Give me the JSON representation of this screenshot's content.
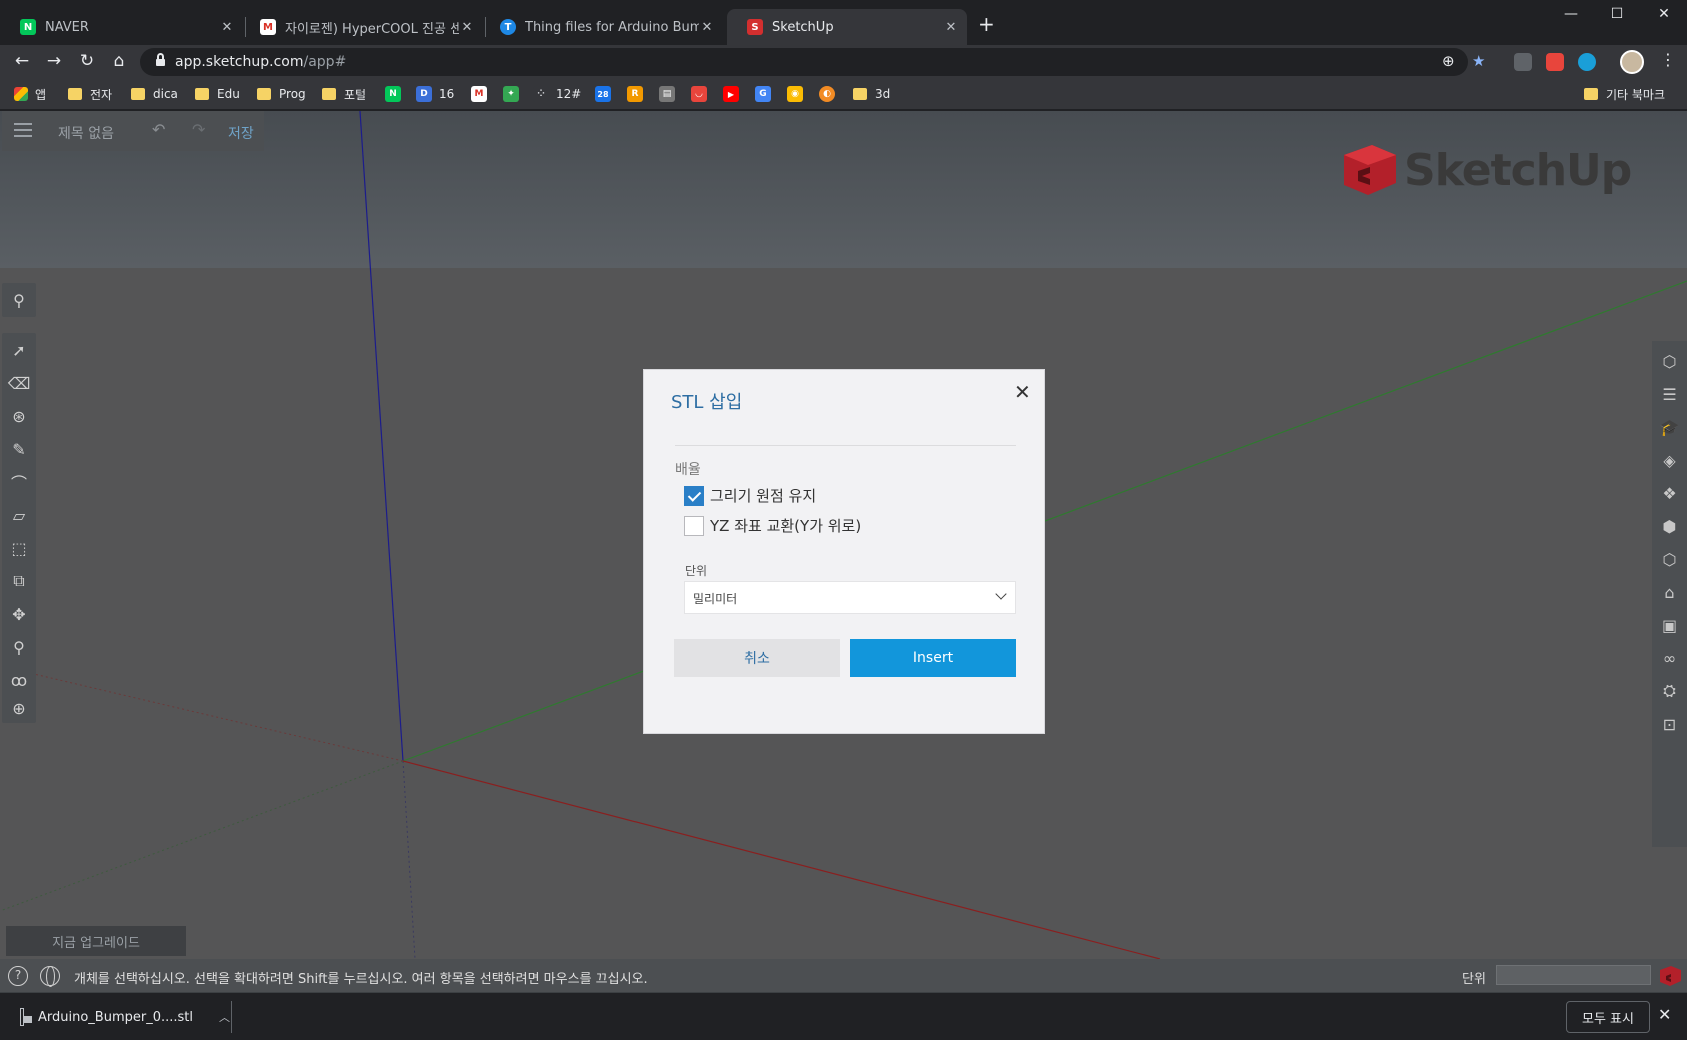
{
  "browser": {
    "tabs": [
      {
        "title": "NAVER",
        "icon": "naver-icon",
        "color": "#03c75a",
        "glyph": "N"
      },
      {
        "title": "자이로젠) HyperCOOL 진공 센서",
        "icon": "gmail-icon",
        "color": "#ffffff",
        "glyph": "M"
      },
      {
        "title": "Thing files for Arduino Bumper",
        "icon": "thingiverse-icon",
        "color": "#1e88e5",
        "glyph": "T"
      },
      {
        "title": "SketchUp",
        "icon": "sketchup-icon",
        "color": "#d32f2f",
        "glyph": "S"
      }
    ],
    "active_tab": 3,
    "new_tab": "+",
    "url_domain": "app.sketchup.com",
    "url_path": "/app#",
    "bookmarks": {
      "apps": "앱",
      "items": [
        {
          "label": "전자",
          "type": "folder"
        },
        {
          "label": "dica",
          "type": "folder"
        },
        {
          "label": "Edu",
          "type": "folder"
        },
        {
          "label": "Prog",
          "type": "folder"
        },
        {
          "label": "포털",
          "type": "folder"
        },
        {
          "label": "",
          "type": "icon",
          "color": "#03c75a",
          "glyph": "N"
        },
        {
          "label": "16",
          "type": "icon",
          "color": "#3b6fd8",
          "glyph": "D"
        },
        {
          "label": "",
          "type": "icon",
          "color": "#d93025",
          "glyph": "M"
        },
        {
          "label": "",
          "type": "icon",
          "color": "#34a853",
          "glyph": "✦"
        },
        {
          "label": "12#",
          "type": "icon",
          "color": "#35363a",
          "glyph": "⁘"
        },
        {
          "label": "",
          "type": "icon",
          "color": "#1a73e8",
          "glyph": "28"
        },
        {
          "label": "",
          "type": "icon",
          "color": "#f29900",
          "glyph": "R"
        },
        {
          "label": "",
          "type": "icon",
          "color": "#777777",
          "glyph": "▤"
        },
        {
          "label": "",
          "type": "icon",
          "color": "#e8453c",
          "glyph": "◡"
        },
        {
          "label": "",
          "type": "icon",
          "color": "#ff0000",
          "glyph": "▶"
        },
        {
          "label": "",
          "type": "icon",
          "color": "#4285f4",
          "glyph": "G"
        },
        {
          "label": "",
          "type": "icon",
          "color": "#fbbc04",
          "glyph": "◉"
        },
        {
          "label": "",
          "type": "icon",
          "color": "#f28b24",
          "glyph": "◐"
        },
        {
          "label": "3d",
          "type": "folder"
        }
      ],
      "other": "기타 북마크"
    }
  },
  "sketchup": {
    "doc_title": "제목 없음",
    "save": "저장",
    "logo_text": "SketchUp",
    "upgrade": "지금 업그레이드",
    "status_message": "개체를 선택하십시오. 선택을 확대하려면 Shift를 누르십시오. 여러 항목을 선택하려면 마우스를 끄십시오.",
    "unit_label": "단위",
    "axis_colors": {
      "blue": "#1c1c8c",
      "green": "#2f7a2f",
      "red": "#8a1f1f"
    }
  },
  "dialog": {
    "title": "STL 삽입",
    "section": "배율",
    "options": [
      {
        "label": "그리기 원점 유지",
        "checked": true
      },
      {
        "label": "YZ 좌표 교환(Y가 위로)",
        "checked": false
      }
    ],
    "unit_caption": "단위",
    "unit_value": "밀리미터",
    "cancel": "취소",
    "insert": "Insert"
  },
  "downloads": {
    "file": "Arduino_Bumper_0....stl",
    "show_all": "모두 표시"
  }
}
